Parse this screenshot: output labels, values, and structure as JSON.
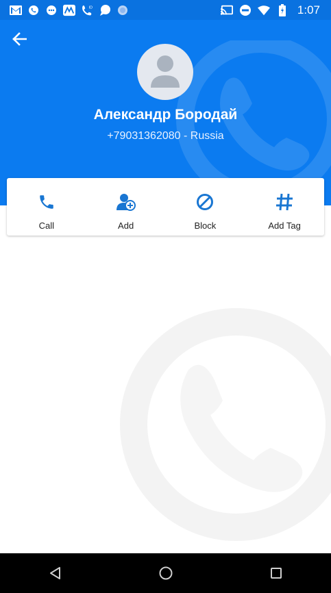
{
  "status_bar": {
    "time": "1:07",
    "left_icons": [
      "gmail-icon",
      "viber-icon",
      "messages-icon",
      "app-icon",
      "phone-id-icon",
      "chat-icon",
      "circle-icon"
    ],
    "right_icons": [
      "cast-icon",
      "do-not-disturb-icon",
      "wifi-icon",
      "battery-icon"
    ]
  },
  "contact": {
    "name": "Александр Бородай",
    "phone": "+79031362080 - Russia"
  },
  "actions": [
    {
      "label": "Call",
      "icon": "phone-icon"
    },
    {
      "label": "Add",
      "icon": "add-contact-icon"
    },
    {
      "label": "Block",
      "icon": "block-icon"
    },
    {
      "label": "Add Tag",
      "icon": "hashtag-icon"
    }
  ],
  "colors": {
    "header": "#0b7bf0",
    "status_bar": "#0a72e0",
    "accent": "#1976d2"
  }
}
